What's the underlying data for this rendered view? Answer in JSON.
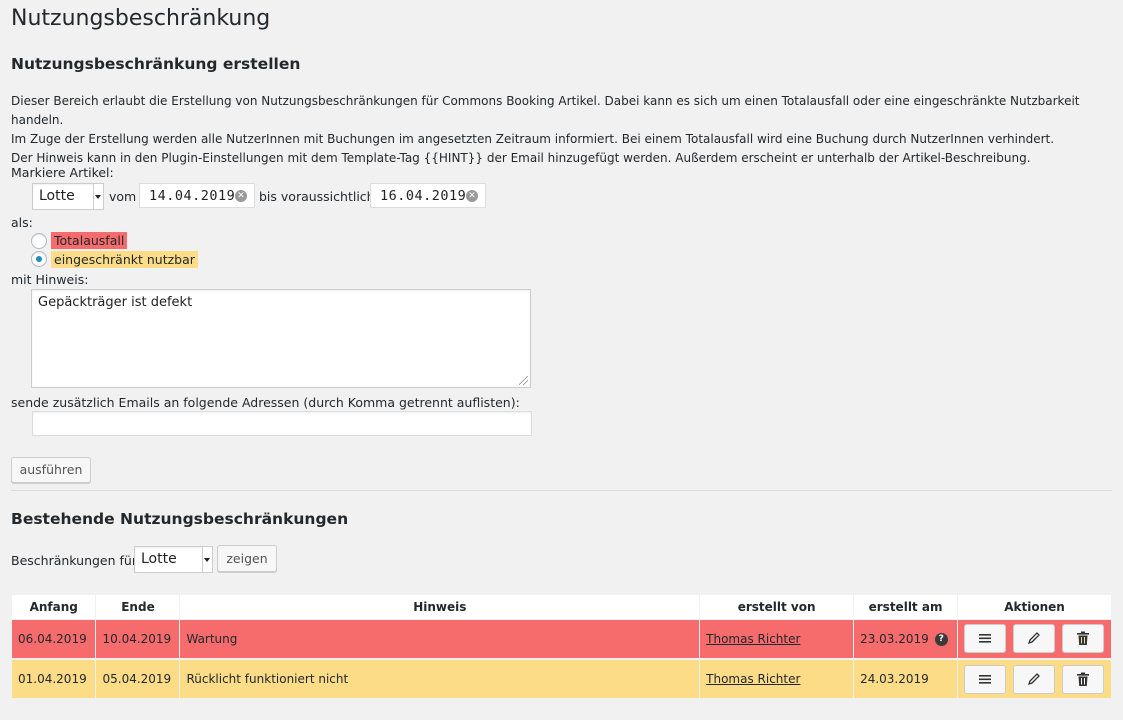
{
  "page": {
    "title": "Nutzungsbeschränkung"
  },
  "create": {
    "heading": "Nutzungsbeschränkung erstellen",
    "description": [
      "Dieser Bereich erlaubt die Erstellung von Nutzungsbeschränkungen für Commons Booking Artikel. Dabei kann es sich um einen Totalausfall oder eine eingeschränkte Nutzbarkeit handeln.",
      "Im Zuge der Erstellung werden alle NutzerInnen mit Buchungen im angesetzten Zeitraum informiert. Bei einem Totalausfall wird eine Buchung durch NutzerInnen verhindert.",
      "Der Hinweis kann in den Plugin-Einstellungen mit dem Template-Tag {{HINT}} der Email hinzugefügt werden. Außerdem erscheint er unterhalb der Artikel-Beschreibung."
    ],
    "item_label": "Markiere Artikel:",
    "item_value": "Lotte",
    "from_label": "vom",
    "from_date": "14.04.2019",
    "to_label": "bis voraussichtlich",
    "to_date": "16.04.2019",
    "as_label": "als:",
    "option_total": "Totalausfall",
    "option_limited": "eingeschränkt nutzbar",
    "selected_option": "eingeschränkt nutzbar",
    "hint_label": "mit Hinweis:",
    "hint_value": "Gepäckträger ist defekt",
    "emails_label": "sende zusätzlich Emails an folgende Adressen (durch Komma getrennt auflisten):",
    "emails_value": "",
    "submit_label": "ausführen",
    "colors": {
      "total": "#f66b6b",
      "limited": "#fddc87"
    }
  },
  "existing": {
    "heading": "Bestehende Nutzungsbeschränkungen",
    "filter_label": "Beschränkungen für:",
    "filter_value": "Lotte",
    "show_label": "zeigen",
    "columns": [
      "Anfang",
      "Ende",
      "Hinweis",
      "erstellt von",
      "erstellt am",
      "Aktionen"
    ],
    "rows": [
      {
        "start": "06.04.2019",
        "end": "10.04.2019",
        "hint": "Wartung",
        "created_by": "Thomas Richter",
        "created_at": "23.03.2019",
        "help_icon": "?",
        "type": "Totalausfall"
      },
      {
        "start": "01.04.2019",
        "end": "05.04.2019",
        "hint": "Rücklicht funktioniert nicht",
        "created_by": "Thomas Richter",
        "created_at": "24.03.2019",
        "type": "eingeschränkt nutzbar"
      }
    ],
    "action_icons": [
      "menu-icon",
      "edit-icon",
      "trash-icon"
    ]
  }
}
